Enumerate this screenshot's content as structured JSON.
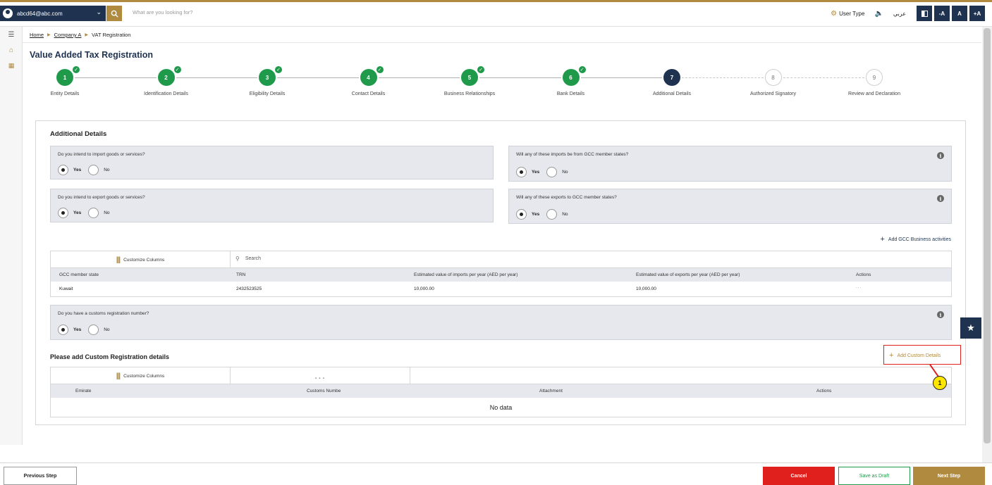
{
  "header": {
    "user_email": "abcd64@abc.com",
    "search_placeholder": "What are you looking for?",
    "user_type": "User Type",
    "language": "عربي",
    "font_decrease": "-A",
    "font_normal": "A",
    "font_increase": "+A"
  },
  "breadcrumb": {
    "home": "Home",
    "company": "Company A",
    "current": "VAT Registration"
  },
  "page_title": "Value Added Tax Registration",
  "steps": [
    {
      "num": "1",
      "label": "Entity Details",
      "status": "done"
    },
    {
      "num": "2",
      "label": "Identification Details",
      "status": "done"
    },
    {
      "num": "3",
      "label": "Eligibility Details",
      "status": "done"
    },
    {
      "num": "4",
      "label": "Contact Details",
      "status": "done"
    },
    {
      "num": "5",
      "label": "Business Relationships",
      "status": "done"
    },
    {
      "num": "6",
      "label": "Bank Details",
      "status": "done"
    },
    {
      "num": "7",
      "label": "Additional Details",
      "status": "current"
    },
    {
      "num": "8",
      "label": "Authorized Signatory",
      "status": "todo"
    },
    {
      "num": "9",
      "label": "Review and Declaration",
      "status": "todo"
    }
  ],
  "form": {
    "section_title": "Additional Details",
    "q_import": "Do you intend to import goods or services?",
    "q_import_gcc": "Will any of these imports be from GCC member states?",
    "q_export": "Do you intend to export goods or services?",
    "q_export_gcc": "Will any of these exports to GCC member states?",
    "q_customs": "Do you have a customs registration number?",
    "yes": "Yes",
    "no": "No",
    "add_gcc": "Add GCC Business activities",
    "custom_section_title": "Please add Custom Registration details",
    "add_custom": "Add Custom Details"
  },
  "gcc_table": {
    "customize": "Customize Columns",
    "search": "Search",
    "headers": [
      "GCC member state",
      "TRN",
      "Estimated value of imports per year (AED per year)",
      "Estimated value of exports per year (AED per year)",
      "Actions"
    ],
    "rows": [
      [
        "Kuwait",
        "2432523525",
        "10,000.00",
        "10,000.00",
        "..."
      ]
    ]
  },
  "custom_table": {
    "customize": "Customize Columns",
    "toolbar_more": "...",
    "headers": [
      "Emirate",
      "Customs Numbe",
      "Attachment",
      "Actions"
    ],
    "empty": "No data"
  },
  "callout_number": "1",
  "footer": {
    "previous": "Previous Step",
    "cancel": "Cancel",
    "draft": "Save as Draft",
    "next": "Next Step"
  },
  "colors": {
    "navy": "#1f3350",
    "gold": "#b08a3e",
    "green": "#1f9a4b",
    "red": "#e0201c"
  }
}
